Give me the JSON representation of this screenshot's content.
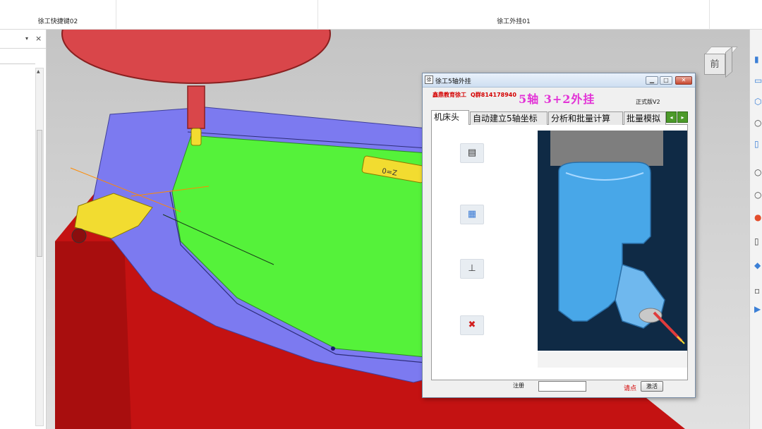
{
  "tabs": [
    {
      "label": "徐工快捷键02"
    },
    {
      "label": "徐工外挂01"
    }
  ],
  "left_panel": {
    "pin_glyph": "▾",
    "close_glyph": "×",
    "scroll_up_glyph": "▲"
  },
  "viewcube": {
    "face_label": "前"
  },
  "right_toolbar": {
    "icons": [
      "select-icon",
      "box-icon",
      "cube-icon",
      "circle-icon",
      "plane-icon",
      "sphere-icon",
      "ring-icon",
      "color-wheel-icon",
      "extrude-icon",
      "shade-icon",
      "flag-icon"
    ]
  },
  "dialog": {
    "title": "徐工5轴外挂",
    "app_icon_glyph": "徐",
    "window_buttons": {
      "minimize": "▁",
      "maximize": "□",
      "close": "✕"
    },
    "brand": "鑫鼎教育徐工",
    "qq": "Q群814178940",
    "headline": "5轴 3+2外挂",
    "version": "正式版V2",
    "tabs": [
      {
        "label": "机床头",
        "active": true
      },
      {
        "label": "自动建立5轴坐标",
        "active": false
      },
      {
        "label": "分析和批量计算",
        "active": false
      },
      {
        "label": "批量模拟",
        "active": false
      }
    ],
    "tab_scroll": {
      "left": "◂",
      "right": "▸"
    },
    "tools": [
      {
        "name": "machine-head-tool-icon",
        "glyph": "▤"
      },
      {
        "name": "stock-tool-icon",
        "glyph": "▦"
      },
      {
        "name": "coordinate-tool-icon",
        "glyph": "⊥"
      },
      {
        "name": "delete-tool-icon",
        "glyph": "✖"
      }
    ],
    "register_label": "注册",
    "register_value": "",
    "hint": "请点",
    "activate_label": "激活"
  },
  "colors": {
    "surface_green": "#55f23a",
    "body_red": "#c41212",
    "fixture_blue": "#7c7af0",
    "tool_red": "#d9464a",
    "highlight_yellow": "#f2dc30",
    "headline_magenta": "#e232d6",
    "preview_bg": "#0f2a45",
    "spindle_blue": "#48a7e8"
  }
}
